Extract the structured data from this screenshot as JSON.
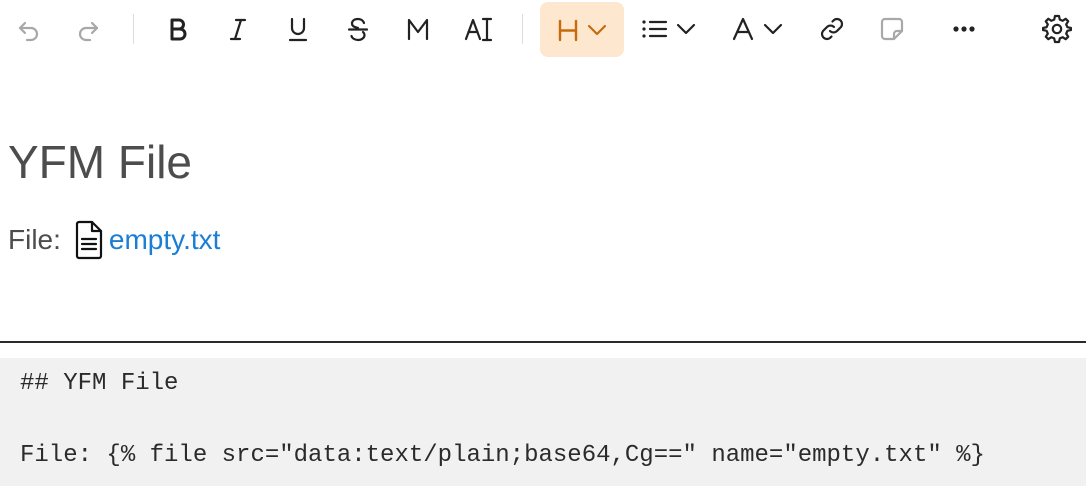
{
  "toolbar": {
    "undo": "undo-icon",
    "redo": "redo-icon",
    "bold": "bold-icon",
    "italic": "italic-icon",
    "underline": "underline-icon",
    "strike": "strikethrough-icon",
    "mono": "monospace-icon",
    "marked": "text-marker-icon",
    "heading": "heading-icon",
    "list": "list-icon",
    "color": "text-color-icon",
    "link": "link-icon",
    "note": "note-icon",
    "more": "more-icon",
    "settings": "gear-icon",
    "colors": {
      "active_bg": "#fde8cf",
      "active_fg": "#c76a0e",
      "disabled": "#a8a8a8"
    }
  },
  "editor": {
    "heading": "YFM File",
    "file_prefix": "File:",
    "file_name": "empty.txt",
    "link_color": "#1a7fd4"
  },
  "source": {
    "line1": "## YFM File",
    "line2": "File: {% file src=\"data:text/plain;base64,Cg==\" name=\"empty.txt\" %}"
  }
}
